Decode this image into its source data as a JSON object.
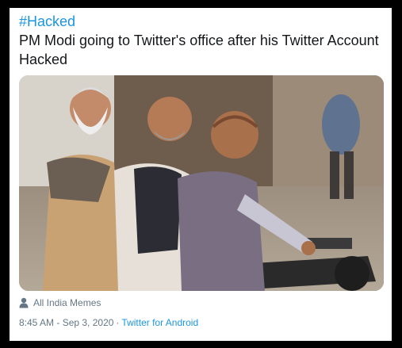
{
  "tweet": {
    "hashtag": "#Hacked",
    "text": "PM Modi going to Twitter's office after his Twitter Account Hacked",
    "media": {
      "alt": "Photo of three men riding a motorcycle on a street"
    },
    "author_name": "All India Memes",
    "timestamp": "8:45 AM - Sep 3, 2020",
    "separator": "·",
    "source": "Twitter for Android"
  },
  "colors": {
    "link": "#1b95e0",
    "text": "#14171a",
    "meta": "#657786",
    "background": "#000000",
    "card": "#ffffff"
  },
  "icons": {
    "author": "user-icon"
  }
}
